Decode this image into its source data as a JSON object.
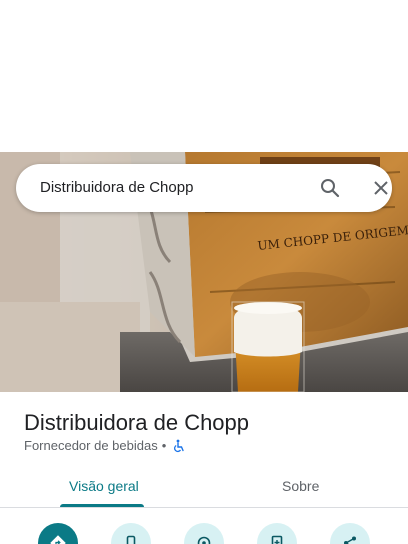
{
  "search": {
    "query": "Distribuidora de Chopp"
  },
  "hero": {
    "sign_text": "UM CHOPP DE ORIGEM"
  },
  "place": {
    "name": "Distribuidora de Chopp",
    "category": "Fornecedor de bebidas",
    "separator": "•",
    "accessibility_icon": "wheelchair-icon"
  },
  "tabs": [
    {
      "label": "Visão geral",
      "selected": true
    },
    {
      "label": "Sobre",
      "selected": false
    }
  ],
  "actions": [
    {
      "icon": "directions-icon"
    },
    {
      "icon": "phone-icon"
    },
    {
      "icon": "location-icon"
    },
    {
      "icon": "save-icon"
    },
    {
      "icon": "share-icon"
    }
  ],
  "colors": {
    "accent": "#0b7a86",
    "action_bg": "#d7f1f3",
    "text_primary": "#202124",
    "text_secondary": "#5f6368"
  }
}
